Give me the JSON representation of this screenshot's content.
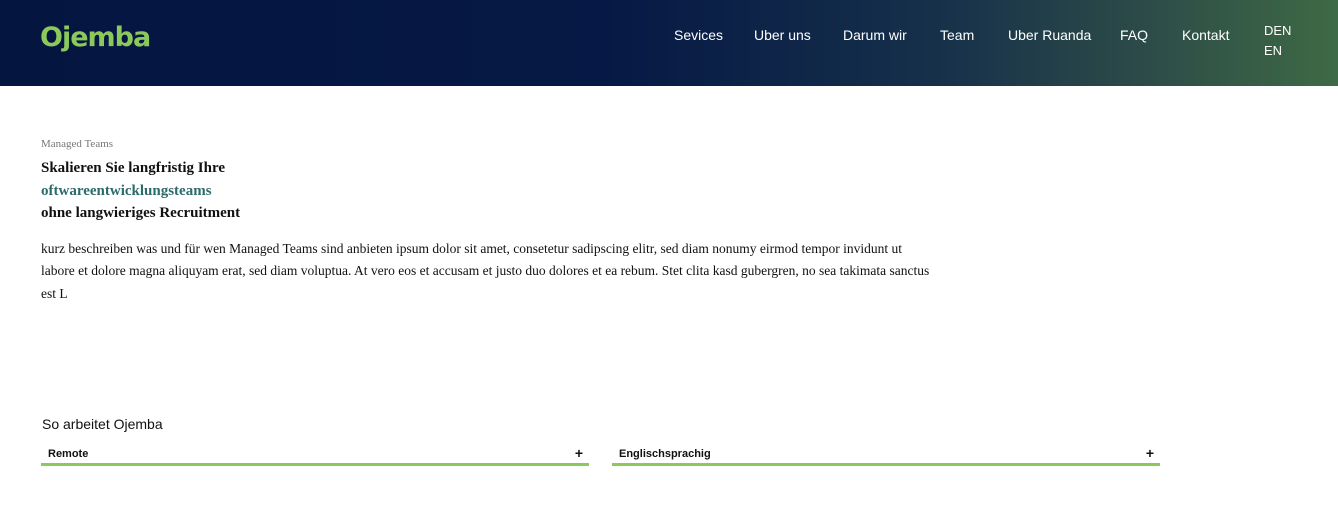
{
  "brand": {
    "logo_text": "Ojemba",
    "logo_color": "#8bc95a"
  },
  "nav": {
    "items": [
      {
        "label": "Sevices"
      },
      {
        "label": "Uber uns"
      },
      {
        "label": "Darum wir"
      },
      {
        "label": "Team"
      },
      {
        "label": "Uber Ruanda"
      },
      {
        "label": "FAQ"
      },
      {
        "label": "Kontakt"
      }
    ],
    "languages": [
      "DEN",
      "EN"
    ]
  },
  "hero": {
    "eyebrow": "Managed Teams",
    "headline_line1": "Skalieren Sie langfristig Ihre",
    "headline_accent": "oftwareentwicklungsteams",
    "headline_line3": "ohne langwieriges Recruitment",
    "lead": "kurz beschreiben was und für wen Managed Teams sind anbieten ipsum dolor sit amet, consetetur sadipscing elitr, sed diam nonumy eirmod tempor invidunt ut labore et dolore magna aliquyam erat, sed diam voluptua. At vero eos et accusam et justo duo dolores et ea rebum. Stet clita kasd gubergren, no sea takimata sanctus est L"
  },
  "how_it_works": {
    "title": "So arbeitet Ojemba",
    "items": [
      {
        "label": "Remote",
        "icon": "plus-icon"
      },
      {
        "label": "Englischsprachig",
        "icon": "plus-icon"
      }
    ]
  },
  "colors": {
    "header_start": "#041540",
    "header_end": "#3e6a45",
    "accent_green": "#8bc95a",
    "accent_teal": "#2d6b6a"
  }
}
